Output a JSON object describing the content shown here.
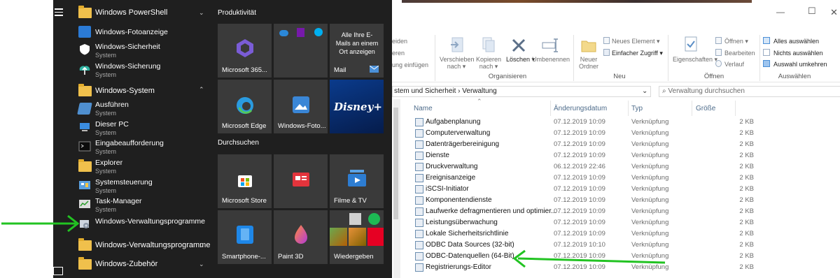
{
  "start_menu": {
    "app_list": [
      {
        "kind": "group",
        "label": "Windows PowerShell",
        "expanded": false
      },
      {
        "kind": "app",
        "name": "Windows-Fotoanzeige",
        "sub": "",
        "icon": "photos-icon"
      },
      {
        "kind": "app",
        "name": "Windows-Sicherheit",
        "sub": "System",
        "icon": "shield-icon"
      },
      {
        "kind": "app",
        "name": "Windows-Sicherung",
        "sub": "System",
        "icon": "backup-icon"
      },
      {
        "kind": "group",
        "label": "Windows-System",
        "expanded": true
      },
      {
        "kind": "app",
        "name": "Ausführen",
        "sub": "System",
        "icon": "run-icon"
      },
      {
        "kind": "app",
        "name": "Dieser PC",
        "sub": "System",
        "icon": "computer-icon"
      },
      {
        "kind": "app",
        "name": "Eingabeaufforderung",
        "sub": "System",
        "icon": "cmd-icon"
      },
      {
        "kind": "app",
        "name": "Explorer",
        "sub": "System",
        "icon": "folder-icon"
      },
      {
        "kind": "app",
        "name": "Systemsteuerung",
        "sub": "System",
        "icon": "control-panel-icon"
      },
      {
        "kind": "app",
        "name": "Task-Manager",
        "sub": "System",
        "icon": "task-manager-icon"
      },
      {
        "kind": "app",
        "name": "Windows-Verwaltungsprogramme",
        "sub": "",
        "icon": "admin-tools-icon"
      },
      {
        "kind": "group",
        "label": "Windows-Verwaltungsprogramme",
        "expanded": false
      },
      {
        "kind": "group",
        "label": "Windows-Zubehör",
        "expanded": false
      }
    ],
    "sections": {
      "productivity": "Produktivität",
      "browse": "Durchsuchen"
    },
    "tiles": {
      "microsoft365": "Microsoft 365...",
      "mail_text": "Alle Ihre E-Mails an einem Ort anzeigen",
      "mail": "Mail",
      "edge": "Microsoft Edge",
      "photos": "Windows-Foto...",
      "disney": "Disney+",
      "store": "Microsoft Store",
      "films": "Filme & TV",
      "phone": "Smartphone-...",
      "paint3d": "Paint 3D",
      "play": "Wiedergeben"
    }
  },
  "explorer": {
    "ribbon": {
      "partial_1": "eiden",
      "partial_2": "eren",
      "partial_3": "ung einfügen",
      "move_to": "Verschieben nach ▾",
      "copy_to": "Kopieren nach ▾",
      "delete": "Löschen ▾",
      "rename": "Umbenennen",
      "new_folder": "Neuer Ordner",
      "new_item": "Neues Element ▾",
      "easy_access": "Einfacher Zugriff ▾",
      "properties": "Eigenschaften ▾",
      "open": "Öffnen ▾",
      "edit": "Bearbeiten",
      "history": "Verlauf",
      "select_all": "Alles auswählen",
      "select_none": "Nichts auswählen",
      "invert": "Auswahl umkehren",
      "group_organize": "Organisieren",
      "group_new": "Neu",
      "group_open": "Öffnen",
      "group_select": "Auswählen"
    },
    "address": "stem und Sicherheit  ›  Verwaltung",
    "search_placeholder": "Verwaltung durchsuchen",
    "columns": {
      "name": "Name",
      "date": "Änderungsdatum",
      "type": "Typ",
      "size": "Größe"
    },
    "files": [
      {
        "name": "Aufgabenplanung",
        "date": "07.12.2019 10:09",
        "type": "Verknüpfung",
        "size": "2 KB"
      },
      {
        "name": "Computerverwaltung",
        "date": "07.12.2019 10:09",
        "type": "Verknüpfung",
        "size": "2 KB"
      },
      {
        "name": "Datenträgerbereinigung",
        "date": "07.12.2019 10:09",
        "type": "Verknüpfung",
        "size": "2 KB"
      },
      {
        "name": "Dienste",
        "date": "07.12.2019 10:09",
        "type": "Verknüpfung",
        "size": "2 KB"
      },
      {
        "name": "Druckverwaltung",
        "date": "06.12.2019 22:46",
        "type": "Verknüpfung",
        "size": "2 KB"
      },
      {
        "name": "Ereignisanzeige",
        "date": "07.12.2019 10:09",
        "type": "Verknüpfung",
        "size": "2 KB"
      },
      {
        "name": "iSCSI-Initiator",
        "date": "07.12.2019 10:09",
        "type": "Verknüpfung",
        "size": "2 KB"
      },
      {
        "name": "Komponentendienste",
        "date": "07.12.2019 10:09",
        "type": "Verknüpfung",
        "size": "2 KB"
      },
      {
        "name": "Laufwerke defragmentieren und optimier...",
        "date": "07.12.2019 10:09",
        "type": "Verknüpfung",
        "size": "2 KB"
      },
      {
        "name": "Leistungsüberwachung",
        "date": "07.12.2019 10:09",
        "type": "Verknüpfung",
        "size": "2 KB"
      },
      {
        "name": "Lokale Sicherheitsrichtlinie",
        "date": "07.12.2019 10:09",
        "type": "Verknüpfung",
        "size": "2 KB"
      },
      {
        "name": "ODBC Data Sources (32-bit)",
        "date": "07.12.2019 10:10",
        "type": "Verknüpfung",
        "size": "2 KB"
      },
      {
        "name": "ODBC-Datenquellen (64-Bit)",
        "date": "07.12.2019 10:09",
        "type": "Verknüpfung",
        "size": "2 KB"
      },
      {
        "name": "Registrierungs-Editor",
        "date": "07.12.2019 10:09",
        "type": "Verknüpfung",
        "size": "2 KB"
      }
    ]
  },
  "colors": {
    "annotation_arrow": "#22c322",
    "start_bg": "#1f1f1f",
    "tile_bg": "#3a3a3a"
  }
}
